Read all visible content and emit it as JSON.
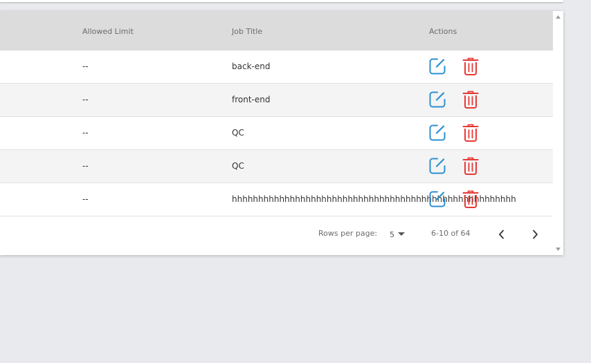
{
  "table": {
    "columns": {
      "allowed_limit": "Allowed Limit",
      "job_title": "Job Title",
      "actions": "Actions"
    },
    "rows": [
      {
        "allowed_limit": "--",
        "job_title": "back-end"
      },
      {
        "allowed_limit": "--",
        "job_title": "front-end"
      },
      {
        "allowed_limit": "--",
        "job_title": "QC"
      },
      {
        "allowed_limit": "--",
        "job_title": "QC"
      },
      {
        "allowed_limit": "--",
        "job_title": "hhhhhhhhhhhhhhhhhhhhhhhhhhhhhhhhhhhhhhhhhhhhhhhhhhhhhh"
      }
    ],
    "icons": {
      "edit": "edit-icon",
      "delete": "trash-icon"
    }
  },
  "pagination": {
    "rows_per_page_label": "Rows per page:",
    "rows_per_page_value": "5",
    "range_text": "6-10 of 64"
  },
  "colors": {
    "edit_icon": "#2b8fcf",
    "delete_icon": "#e53935",
    "header_bg": "#dcdcdc",
    "page_bg": "#e8eaed"
  }
}
